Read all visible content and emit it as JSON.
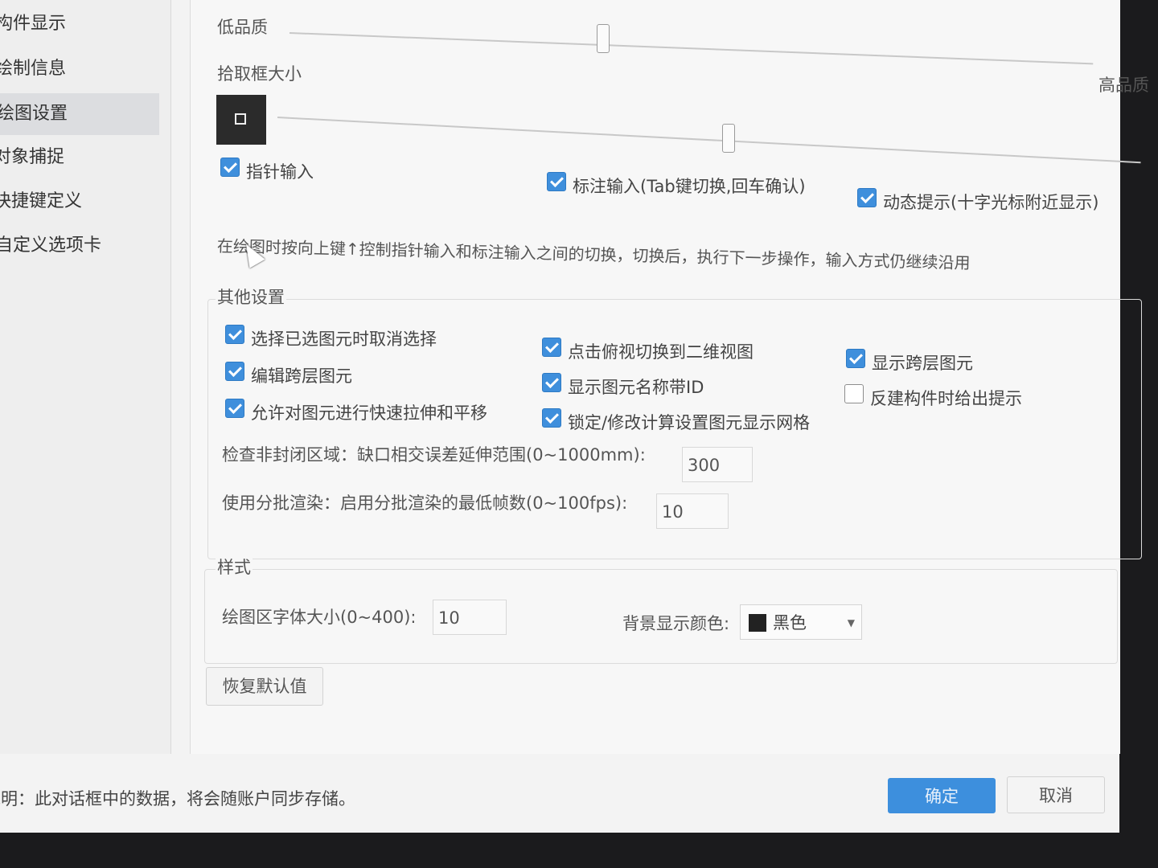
{
  "sidebar": {
    "items": [
      {
        "label": "构件显示"
      },
      {
        "label": "绘制信息"
      },
      {
        "label": "绘图设置"
      },
      {
        "label": "对象捕捉"
      },
      {
        "label": "快捷键定义"
      },
      {
        "label": "自定义选项卡"
      }
    ],
    "active_index": 2
  },
  "quality": {
    "low_label": "低品质",
    "high_label": "高品质",
    "level": 0.38
  },
  "pickbox": {
    "label": "拾取框大小",
    "level": 0.52
  },
  "input_mode": {
    "pointer_input": {
      "label": "指针输入",
      "checked": true
    },
    "dimension_input": {
      "label": "标注输入(Tab键切换,回车确认)",
      "checked": true
    },
    "dynamic_prompt": {
      "label": "动态提示(十字光标附近显示)",
      "checked": true
    },
    "note": "在绘图时按向上键↑控制指针输入和标注输入之间的切换，切换后，执行下一步操作，输入方式仍继续沿用"
  },
  "other": {
    "title": "其他设置",
    "options": [
      {
        "label": "选择已选图元时取消选择",
        "checked": true
      },
      {
        "label": "编辑跨层图元",
        "checked": true
      },
      {
        "label": "允许对图元进行快速拉伸和平移",
        "checked": true
      },
      {
        "label": "点击俯视切换到二维视图",
        "checked": true
      },
      {
        "label": "显示图元名称带ID",
        "checked": true
      },
      {
        "label": "锁定/修改计算设置图元显示网格",
        "checked": true
      },
      {
        "label": "显示跨层图元",
        "checked": true
      },
      {
        "label": "反建构件时给出提示",
        "checked": false
      }
    ],
    "unclosed_label": "检查非封闭区域：缺口相交误差延伸范围(0~1000mm):",
    "unclosed_value": "300",
    "batch_label": "使用分批渲染：启用分批渲染的最低帧数(0~100fps):",
    "batch_value": "10"
  },
  "style": {
    "title": "样式",
    "font_size_label": "绘图区字体大小(0~400):",
    "font_size_value": "10",
    "bg_color_label": "背景显示颜色:",
    "bg_color_value": "黑色",
    "bg_color_swatch": "#222222"
  },
  "buttons": {
    "restore": "恢复默认值",
    "ok": "确定",
    "cancel": "取消"
  },
  "footer": {
    "note": "说明：此对话框中的数据，将会随账户同步存储。"
  },
  "colors": {
    "accent": "#3d8fdd",
    "dark_bg": "#1b1b1d"
  }
}
